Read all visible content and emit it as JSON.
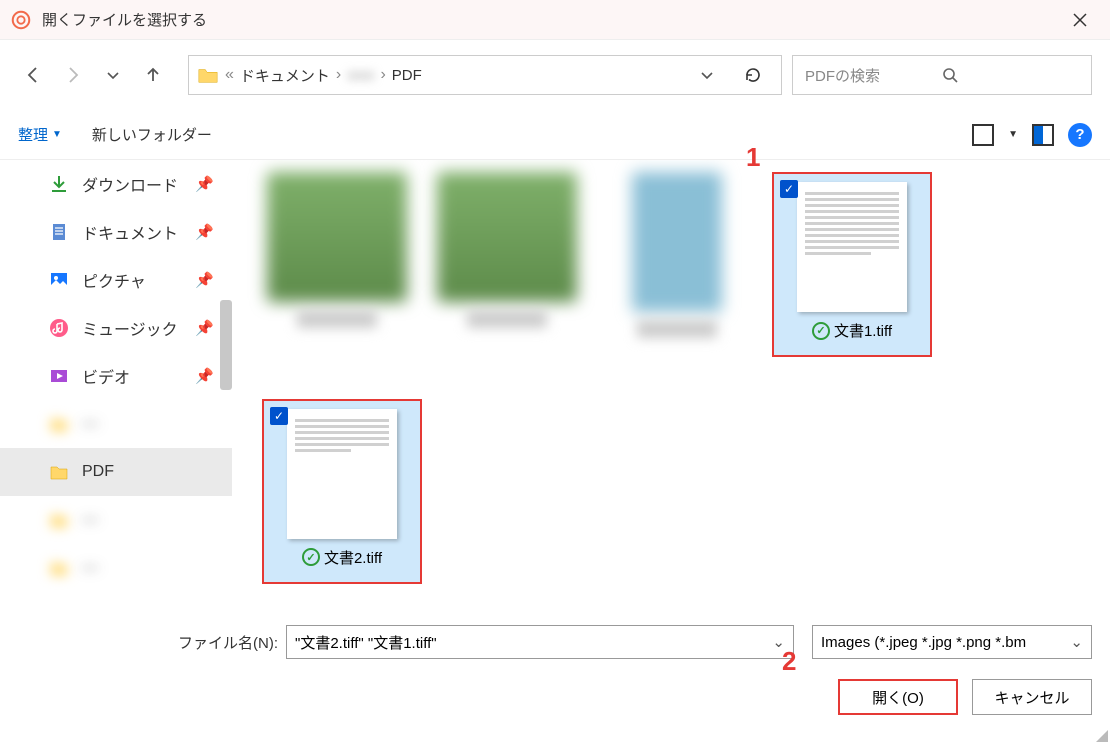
{
  "title": "開くファイルを選択する",
  "breadcrumb": {
    "seg1": "ドキュメント",
    "seg2": "●●●",
    "seg3": "PDF"
  },
  "search": {
    "placeholder": "PDFの検索"
  },
  "toolbar": {
    "organize": "整理",
    "newfolder": "新しいフォルダー"
  },
  "sidebar": {
    "items": [
      {
        "label": "ダウンロード",
        "icon": "download"
      },
      {
        "label": "ドキュメント",
        "icon": "document"
      },
      {
        "label": "ピクチャ",
        "icon": "picture"
      },
      {
        "label": "ミュージック",
        "icon": "music"
      },
      {
        "label": "ビデオ",
        "icon": "video"
      },
      {
        "label": "—",
        "icon": "folder-blur"
      },
      {
        "label": "PDF",
        "icon": "folder",
        "selected": true
      },
      {
        "label": "—",
        "icon": "folder-blur"
      },
      {
        "label": "—",
        "icon": "folder-blur"
      }
    ]
  },
  "files": {
    "selected": [
      {
        "name": "文書1.tiff"
      },
      {
        "name": "文書2.tiff"
      }
    ]
  },
  "bottom": {
    "filename_label": "ファイル名(N):",
    "filename_value": "\"文書2.tiff\" \"文書1.tiff\"",
    "filetype": "Images (*.jpeg *.jpg *.png *.bm",
    "open": "開く(O)",
    "cancel": "キャンセル"
  },
  "annotations": {
    "one": "1",
    "two": "2"
  }
}
